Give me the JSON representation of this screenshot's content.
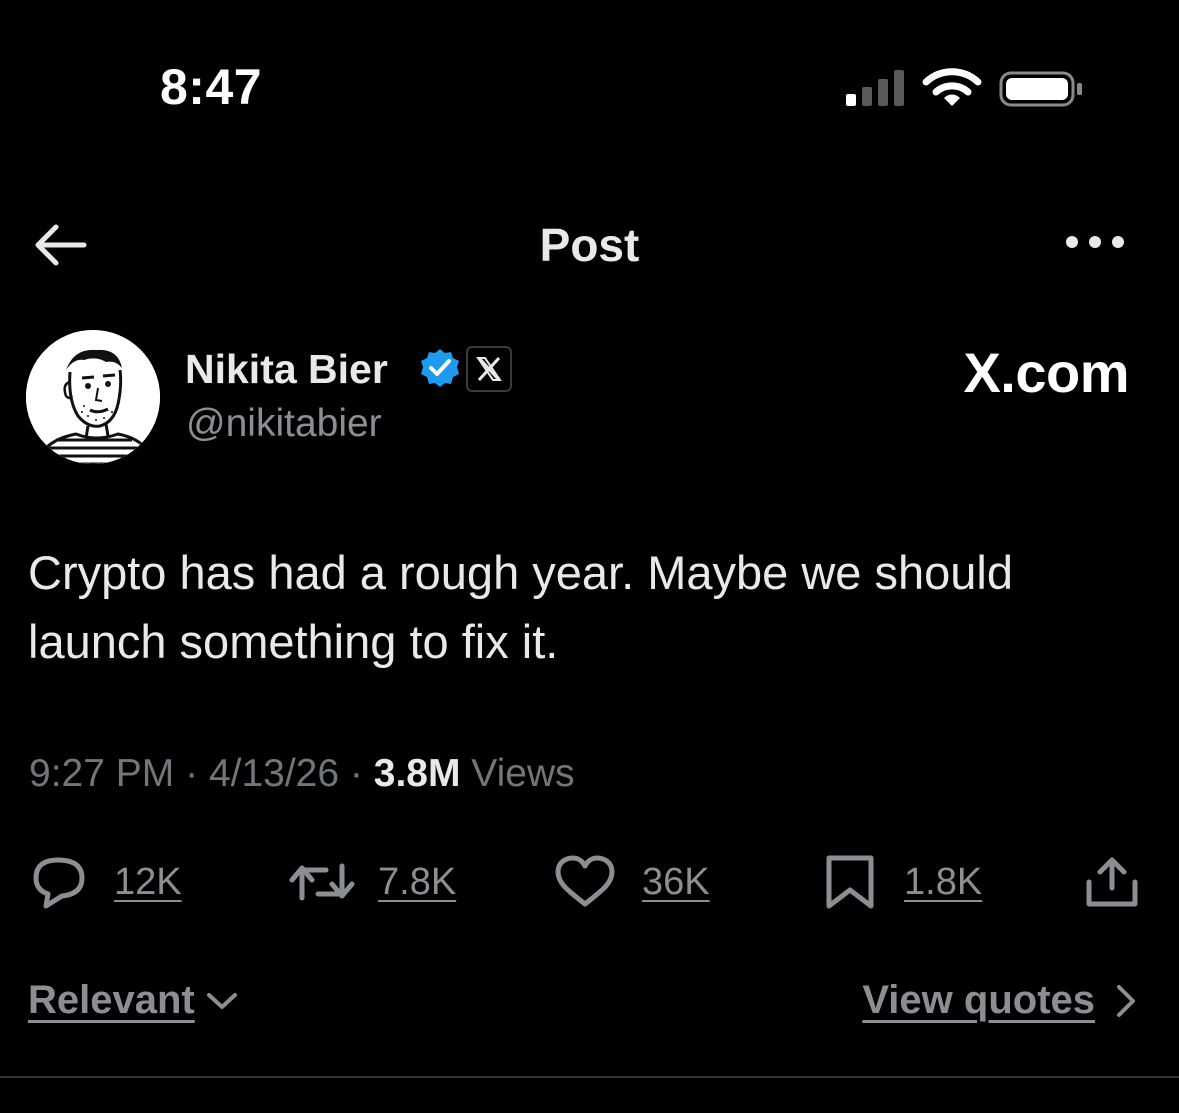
{
  "status_bar": {
    "time": "8:47"
  },
  "nav": {
    "title": "Post",
    "back_icon": "arrow-left-icon",
    "more_icon": "more-dots-icon"
  },
  "author": {
    "name": "Nikita Bier",
    "handle": "@nikitabier",
    "affiliation_label": "X.com",
    "verified_color": "#1d9bf0"
  },
  "tweet": {
    "text": "Crypto has had a rough year. Maybe we should launch something to fix it."
  },
  "meta": {
    "time": "9:27 PM",
    "separator": "·",
    "date": "4/13/26",
    "views_count": "3.8M",
    "views_label": "Views"
  },
  "actions": {
    "replies": "12K",
    "reposts": "7.8K",
    "likes": "36K",
    "bookmarks": "1.8K"
  },
  "footer": {
    "sort_label": "Relevant",
    "view_quotes_label": "View quotes"
  }
}
